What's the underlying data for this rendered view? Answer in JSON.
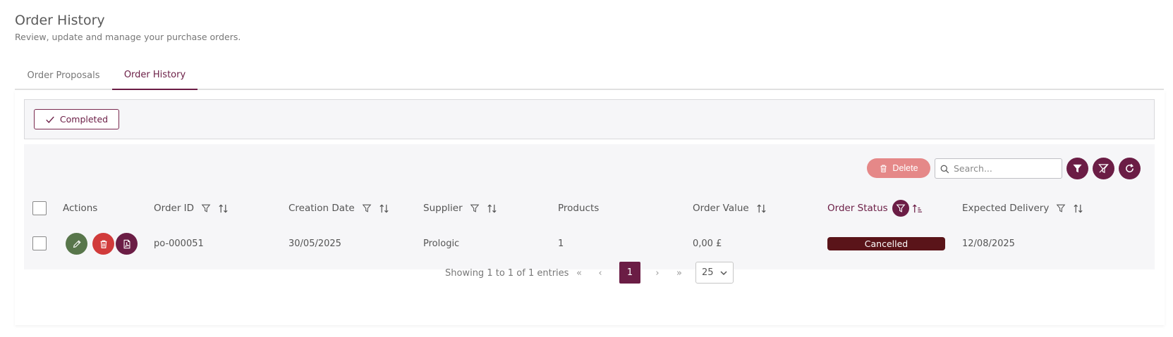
{
  "page": {
    "title": "Order History",
    "subtitle": "Review, update and manage your purchase orders."
  },
  "tabs": [
    {
      "label": "Order Proposals",
      "active": false
    },
    {
      "label": "Order History",
      "active": true
    }
  ],
  "filter_bar": {
    "chip_label": "Completed"
  },
  "toolbar": {
    "delete_label": "Delete",
    "search_placeholder": "Search...",
    "search_value": ""
  },
  "table": {
    "columns": {
      "actions": "Actions",
      "order_id": "Order ID",
      "creation_date": "Creation Date",
      "supplier": "Supplier",
      "products": "Products",
      "order_value": "Order Value",
      "order_status": "Order Status",
      "expected_delivery": "Expected Delivery"
    },
    "rows": [
      {
        "order_id": "po-000051",
        "creation_date": "30/05/2025",
        "supplier": "Prologic",
        "products": "1",
        "order_value": "0,00 £",
        "order_status": "Cancelled",
        "expected_delivery": "12/08/2025"
      }
    ]
  },
  "pagination": {
    "info": "Showing 1 to 1 of 1 entries",
    "first": "«",
    "prev": "‹",
    "current_page": "1",
    "next": "›",
    "last": "»",
    "page_size": "25"
  },
  "colors": {
    "brand": "#6b1d45",
    "edit": "#58764b",
    "delete": "#d13b3b",
    "delete_light": "#e58888",
    "cancelled": "#5a1419"
  }
}
